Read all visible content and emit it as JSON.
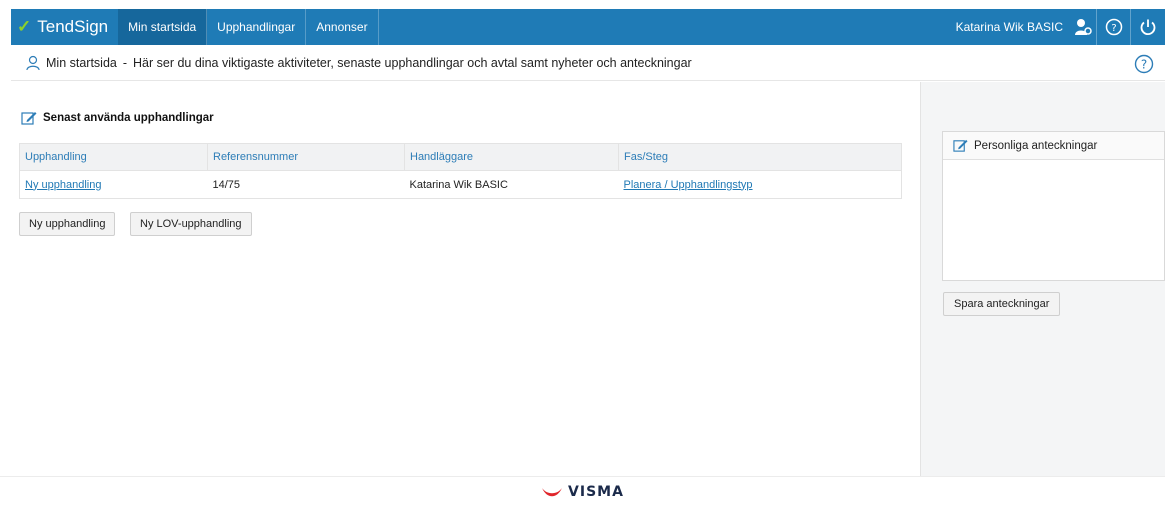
{
  "app": {
    "brand": "TendSign"
  },
  "nav": {
    "tabs": [
      {
        "label": "Min startsida",
        "active": true
      },
      {
        "label": "Upphandlingar",
        "active": false
      },
      {
        "label": "Annonser",
        "active": false
      }
    ],
    "user_name": "Katarina Wik BASIC",
    "icons": [
      "user-settings-icon",
      "help-icon",
      "power-icon"
    ]
  },
  "subheader": {
    "title": "Min startsida",
    "separator": "-",
    "description": "Här ser du dina viktigaste aktiviteter, senaste upphandlingar och avtal samt nyheter och anteckningar"
  },
  "recent": {
    "title": "Senast använda upphandlingar",
    "columns": [
      "Upphandling",
      "Referensnummer",
      "Handläggare",
      "Fas/Steg"
    ],
    "rows": [
      {
        "upphandling": "Ny upphandling",
        "referensnummer": "14/75",
        "handlaggare": "Katarina Wik BASIC",
        "fas_steg": "Planera / Upphandlingstyp"
      }
    ],
    "buttons": {
      "new": "Ny upphandling",
      "new_lov": "Ny LOV-upphandling"
    }
  },
  "notes": {
    "title": "Personliga anteckningar",
    "value": "",
    "save_label": "Spara anteckningar"
  },
  "footer": {
    "logo_text": "VISMA"
  },
  "colors": {
    "nav_bg": "#1f7bb6",
    "nav_active": "#16679c",
    "link": "#1f78b4",
    "brand_leaf": "#8bd12b",
    "visma_red": "#e0262b"
  }
}
